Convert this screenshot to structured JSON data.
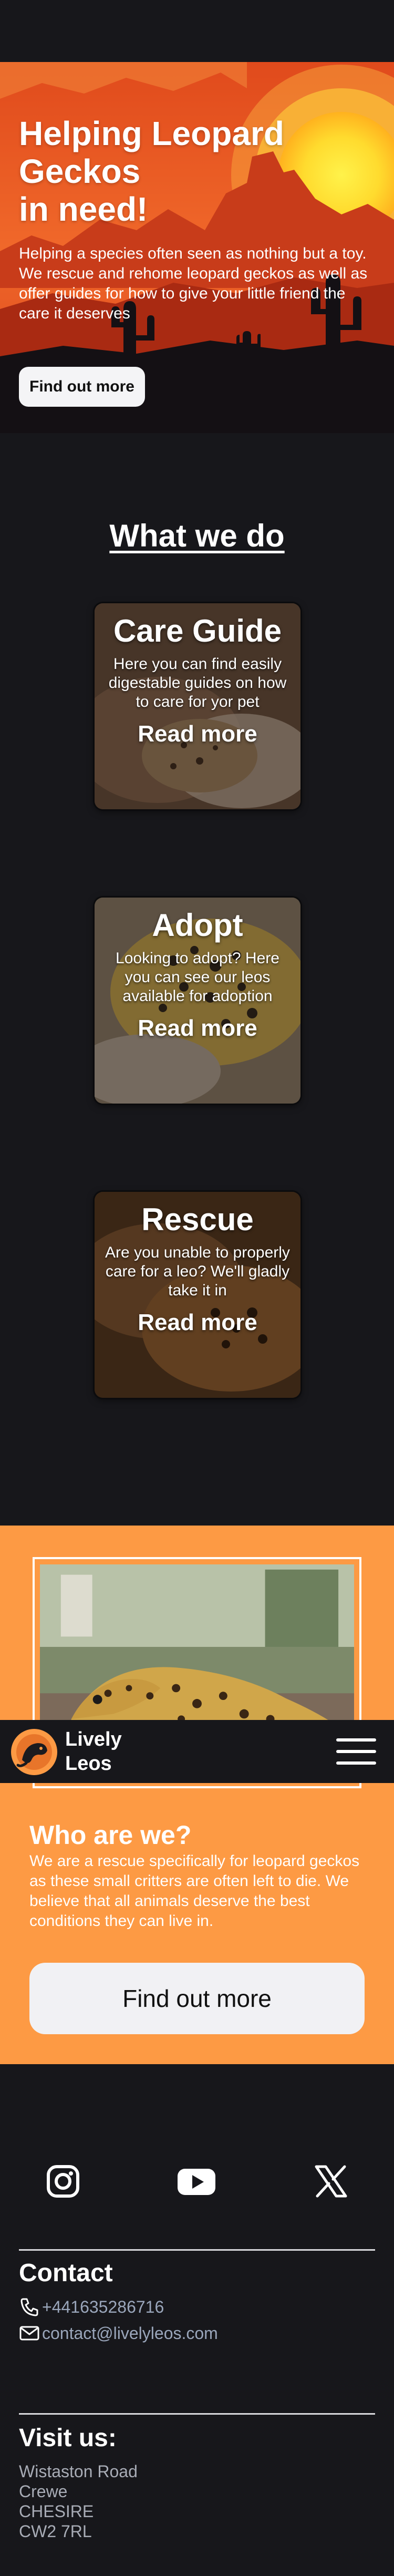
{
  "hero": {
    "title": "Helping Leopard\nGeckos\nin need!",
    "text": "Helping a species often seen as nothing but a toy. We rescue and rehome leopard geckos as well as offer guides for how to give your little friend the care it deserves",
    "button_label": "Find out more"
  },
  "what_we_do": {
    "title": "What we do",
    "cards": [
      {
        "title": "Care Guide",
        "text": "Here you can find easily digestable guides on how to care for yor pet",
        "link": "Read more"
      },
      {
        "title": "Adopt",
        "text": "Looking to adopt? Here you can see our leos available for adoption",
        "link": "Read more"
      },
      {
        "title": "Rescue",
        "text": "Are you unable to properly care for a leo? We'll gladly take it in",
        "link": "Read more"
      }
    ]
  },
  "navbar": {
    "brand": "Lively\nLeos"
  },
  "about": {
    "title": "Who are we?",
    "text": "We are a rescue specifically for leopard geckos as these small critters are often left to die. We believe that all animals deserve the best conditions they can live in.",
    "button_label": "Find out more"
  },
  "footer": {
    "social": [
      "instagram-icon",
      "youtube-icon",
      "x-icon"
    ],
    "contact_heading": "Contact",
    "phone": "+441635286716",
    "email": "contact@livelyleos.com",
    "visit_heading": "Visit us:",
    "address": [
      "Wistaston Road",
      "Crewe",
      "CHESIRE",
      "CW2 7RL"
    ]
  },
  "colors": {
    "background": "#17171b",
    "accent_orange": "#fd9a44",
    "button_light": "#f4f4f6",
    "link_grey": "#9aa6bb"
  }
}
